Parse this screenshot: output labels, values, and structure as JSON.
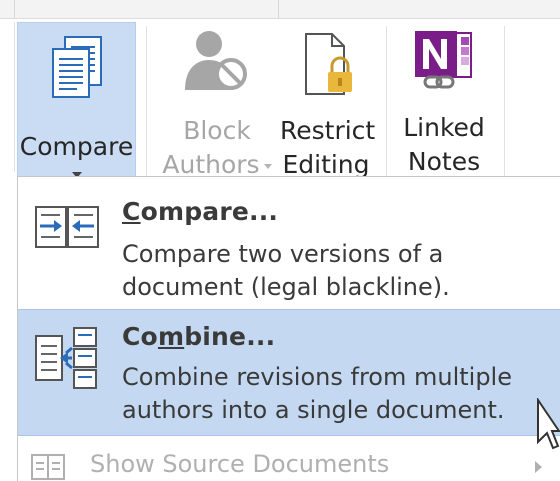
{
  "ribbon": {
    "compare_button": {
      "label": "Compare",
      "icon": "compare-documents-icon"
    },
    "block_authors_button": {
      "label_line1": "Block",
      "label_line2": "Authors",
      "icon": "block-authors-icon",
      "enabled": false
    },
    "restrict_editing_button": {
      "label_line1": "Restrict",
      "label_line2": "Editing",
      "icon": "lock-document-icon"
    },
    "linked_notes_button": {
      "label_line1": "Linked",
      "label_line2": "Notes",
      "icon": "onenote-link-icon"
    }
  },
  "menu": {
    "items": [
      {
        "title": "Compare...",
        "access_key": "C",
        "description_line1": "Compare two versions of a",
        "description_line2": "document (legal blackline).",
        "icon": "compare-versions-icon"
      },
      {
        "title": "Combine...",
        "access_key": "b",
        "description_line1": "Combine revisions from multiple",
        "description_line2": "authors into a single document.",
        "icon": "combine-revisions-icon",
        "highlighted": true
      },
      {
        "title": "Show Source Documents",
        "icon": "source-documents-icon",
        "enabled": false,
        "has_submenu": true
      }
    ]
  },
  "colors": {
    "selected_background": "#c9dcf3",
    "highlight_background": "#c4d9f1",
    "disabled_text": "#a6a6a6",
    "onenote_purple": "#7a1d88",
    "lock_gold": "#e8b73b",
    "accent_blue": "#2b6cb8"
  }
}
